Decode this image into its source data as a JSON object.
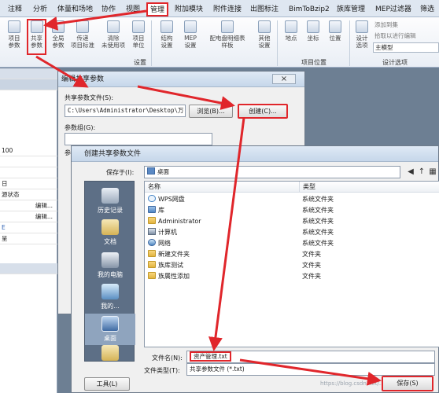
{
  "ribbon": {
    "tabs": [
      "注释",
      "分析",
      "体量和场地",
      "协作",
      "视图",
      "管理",
      "附加模块",
      "附件连接",
      "出图标注",
      "BimToBzip2",
      "族库管理",
      "MEP过滤器",
      "筛选"
    ],
    "active_tab": "管理",
    "buttons": {
      "project_params": "项目\n参数",
      "shared_params": "共享\n参数",
      "global_params": "全局\n参数",
      "transfer_standards": "传递\n项目标准",
      "purge_unused": "清除\n未使用项",
      "project_units": "项目\n单位",
      "structural_settings": "结构\n设置",
      "mep_settings": "MEP\n设置",
      "panel_schedules": "配电盘明细表\n样板",
      "other_settings": "其他\n设置",
      "location": "地点",
      "coordinates": "坐标",
      "position": "位置",
      "design_options": "设计\n选项",
      "add_to_set": "添加到集",
      "pick_to_edit": "拾取以进行编辑",
      "main_model": "主模型"
    },
    "groups": {
      "settings": "设置",
      "project_location": "项目位置",
      "design_options": "设计选项"
    }
  },
  "left_panel": {
    "rows": [
      "",
      "",
      "100",
      "",
      "",
      "日",
      "源状态",
      "编辑...",
      "编辑...",
      "E",
      "呈",
      "",
      "",
      "",
      "",
      "",
      ""
    ]
  },
  "dialog_edit": {
    "title": "编辑共享参数",
    "close": "×",
    "file_label": "共享参数文件(S):",
    "file_path": "C:\\Users\\Administrator\\Desktop\\万:",
    "browse_button": "浏览(B)...",
    "create_button": "创建(C)...",
    "group_label": "参数组(G):",
    "group_value": "",
    "params_label": "参"
  },
  "dialog_create": {
    "title": "创建共享参数文件",
    "save_in_label": "保存于(I):",
    "save_in_value": "桌面",
    "places": [
      "历史记录",
      "文档",
      "我的电脑",
      "我的...",
      "桌面",
      ""
    ],
    "columns": {
      "name": "名称",
      "type": "类型"
    },
    "files": [
      {
        "name": "WPS网盘",
        "type": "系统文件夹",
        "icon": "cloud-icon"
      },
      {
        "name": "库",
        "type": "系统文件夹",
        "icon": "library-icon"
      },
      {
        "name": "Administrator",
        "type": "系统文件夹",
        "icon": "user-icon"
      },
      {
        "name": "计算机",
        "type": "系统文件夹",
        "icon": "computer-icon"
      },
      {
        "name": "网络",
        "type": "系统文件夹",
        "icon": "network-icon"
      },
      {
        "name": "新建文件夹",
        "type": "文件夹",
        "icon": "folder-icon"
      },
      {
        "name": "族库测试",
        "type": "文件夹",
        "icon": "folder-icon"
      },
      {
        "name": "族属性添加",
        "type": "文件夹",
        "icon": "folder-icon"
      }
    ],
    "filename_label": "文件名(N):",
    "filename_value": "资产管理.txt",
    "filetype_label": "文件类型(T):",
    "filetype_value": "共享参数文件 (*.txt)",
    "tools_button": "工具(L)",
    "save_button": "保存(S)",
    "watermark": "https://blog.csdn.net/..."
  },
  "colors": {
    "highlight": "#e0262b"
  }
}
